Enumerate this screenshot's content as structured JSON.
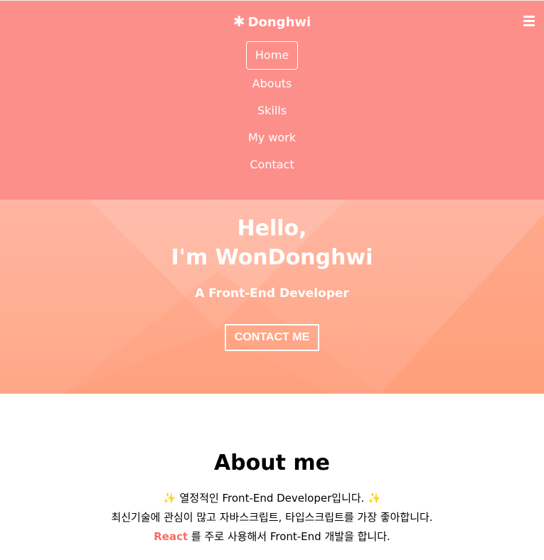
{
  "navbar": {
    "logo_icon": "asterisk-icon",
    "logo": "Donghwi",
    "toggle_icon": "hamburger-menu-icon",
    "menu": [
      {
        "label": "Home",
        "active": true
      },
      {
        "label": "Abouts",
        "active": false
      },
      {
        "label": "Skills",
        "active": false
      },
      {
        "label": "My work",
        "active": false
      },
      {
        "label": "Contact",
        "active": false
      }
    ]
  },
  "home": {
    "title_line1": "Hello,",
    "title_line2": "I'm WonDonghwi",
    "subtitle": "A Front-End Developer",
    "contact_button": "CONTACT ME"
  },
  "about": {
    "title": "About me",
    "line1": "✨ 열정적인 Front-End Developer입니다. ✨",
    "line2": "최신기술에 관심이 많고 자바스크립트, 타입스크립트를 가장 좋아합니다.",
    "line3_highlight": "React",
    "line3_rest": " 를 주로 사용해서 Front-End 개발을 합니다."
  },
  "colors": {
    "navbar_bg": "#fd8f8b",
    "home_bg_top": "#ffb19d",
    "home_bg_bottom": "#ffa27f",
    "accent": "#fd6a63"
  }
}
